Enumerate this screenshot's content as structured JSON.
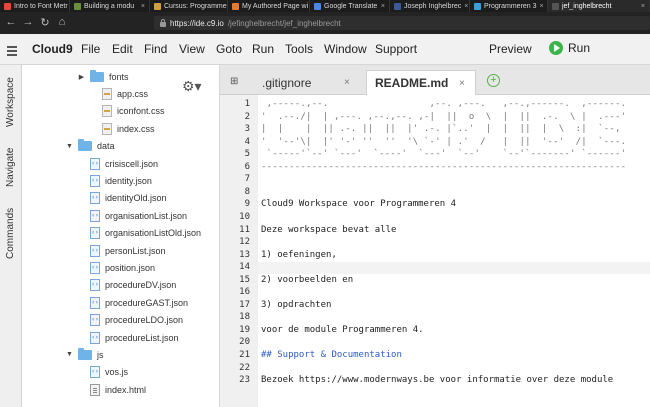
{
  "browser": {
    "tabs": [
      {
        "title": "Intro to Font Metr",
        "color": "#e04a3a"
      },
      {
        "title": "Building a modu",
        "color": "#6a8f3a"
      },
      {
        "title": "Cursus: Programmer",
        "color": "#d0a13a"
      },
      {
        "title": "My Authored Page wi",
        "color": "#e07b30"
      },
      {
        "title": "Google Translate",
        "color": "#4a86e8"
      },
      {
        "title": "Joseph Inghelbrec",
        "color": "#3b5998"
      },
      {
        "title": "Programmeren 3",
        "color": "#3aa0d8"
      },
      {
        "title": "jef_inghelbrecht",
        "color": "#555555"
      }
    ],
    "url_host": "https://ide.c9.io",
    "url_path": "/jefinghelbrecht/jef_inghelbrecht"
  },
  "menubar": {
    "brand": "Cloud9",
    "items": [
      "File",
      "Edit",
      "Find",
      "View",
      "Goto",
      "Run",
      "Tools",
      "Window",
      "Support"
    ],
    "preview": "Preview",
    "run": "Run"
  },
  "rail": {
    "workspace": "Workspace",
    "navigate": "Navigate",
    "commands": "Commands"
  },
  "tree": [
    {
      "name": "fonts",
      "type": "folder",
      "expanded": false,
      "depth": 1
    },
    {
      "name": "app.css",
      "type": "css",
      "depth": 2
    },
    {
      "name": "iconfont.css",
      "type": "css",
      "depth": 2
    },
    {
      "name": "index.css",
      "type": "css",
      "depth": 2
    },
    {
      "name": "data",
      "type": "folder",
      "expanded": true,
      "depth": 0
    },
    {
      "name": "crisiscell.json",
      "type": "json",
      "depth": 1
    },
    {
      "name": "identity.json",
      "type": "json",
      "depth": 1
    },
    {
      "name": "identityOld.json",
      "type": "json",
      "depth": 1
    },
    {
      "name": "organisationList.json",
      "type": "json",
      "depth": 1
    },
    {
      "name": "organisationListOld.json",
      "type": "json",
      "depth": 1
    },
    {
      "name": "personList.json",
      "type": "json",
      "depth": 1
    },
    {
      "name": "position.json",
      "type": "json",
      "depth": 1
    },
    {
      "name": "procedureDV.json",
      "type": "json",
      "depth": 1
    },
    {
      "name": "procedureGAST.json",
      "type": "json",
      "depth": 1
    },
    {
      "name": "procedureLDO.json",
      "type": "json",
      "depth": 1
    },
    {
      "name": "procedureList.json",
      "type": "json",
      "depth": 1
    },
    {
      "name": "js",
      "type": "folder",
      "expanded": true,
      "depth": 0
    },
    {
      "name": "vos.js",
      "type": "json",
      "depth": 1
    },
    {
      "name": "index.html",
      "type": "html",
      "depth": 0
    }
  ],
  "editor": {
    "tabs": [
      {
        "label": ".gitignore",
        "active": false
      },
      {
        "label": "README.md",
        "active": true
      }
    ],
    "close": "×",
    "add": "+",
    "lines": [
      {
        "n": "1",
        "text": " ,-----.,--.                  ,--. ,---.   ,--.,------.  ,------.",
        "kind": "ascii"
      },
      {
        "n": "2",
        "text": "'  .--./|  | ,---. ,--.,--. ,-|  ||  o  \\  |  ||  .-.  \\ |  .---'",
        "kind": "ascii"
      },
      {
        "n": "3",
        "text": "|  |    |  || .-. ||  ||  |' .-. |`..'  |  |  ||  |  \\  :|  `--,",
        "kind": "ascii"
      },
      {
        "n": "4",
        "text": "'  '--'\\|  |' '-' ''  ''  '\\ `-' | .'  /   |  ||  '--'  /|  `---.",
        "kind": "ascii"
      },
      {
        "n": "5",
        "text": " `-----'`--' `---'  `----'  `---'  `--'    `--'`-------' `------'",
        "kind": "ascii"
      },
      {
        "n": "6",
        "text": "-----------------------------------------------------------------",
        "kind": "ascii"
      },
      {
        "n": "7",
        "text": "",
        "kind": "text"
      },
      {
        "n": "8",
        "text": "",
        "kind": "text"
      },
      {
        "n": "9",
        "text": "Cloud9 Workspace voor Programmeren 4",
        "kind": "text"
      },
      {
        "n": "10",
        "text": "",
        "kind": "text"
      },
      {
        "n": "11",
        "text": "Deze workspace bevat alle",
        "kind": "text"
      },
      {
        "n": "12",
        "text": "",
        "kind": "text"
      },
      {
        "n": "13",
        "text": "1) oefeningen,",
        "kind": "text"
      },
      {
        "n": "14",
        "text": "",
        "kind": "text"
      },
      {
        "n": "15",
        "text": "2) voorbeelden en",
        "kind": "text"
      },
      {
        "n": "16",
        "text": "",
        "kind": "text"
      },
      {
        "n": "17",
        "text": "3) opdrachten",
        "kind": "text"
      },
      {
        "n": "18",
        "text": "",
        "kind": "text"
      },
      {
        "n": "19",
        "text": "voor de module Programmeren 4.",
        "kind": "text"
      },
      {
        "n": "20",
        "text": "",
        "kind": "text"
      },
      {
        "n": "21",
        "text": "## Support & Documentation",
        "kind": "heading"
      },
      {
        "n": "22",
        "text": "",
        "kind": "text"
      },
      {
        "n": "23",
        "text": "Bezoek https://www.modernways.be voor informatie over deze module",
        "kind": "text"
      }
    ],
    "current_line": "14"
  }
}
